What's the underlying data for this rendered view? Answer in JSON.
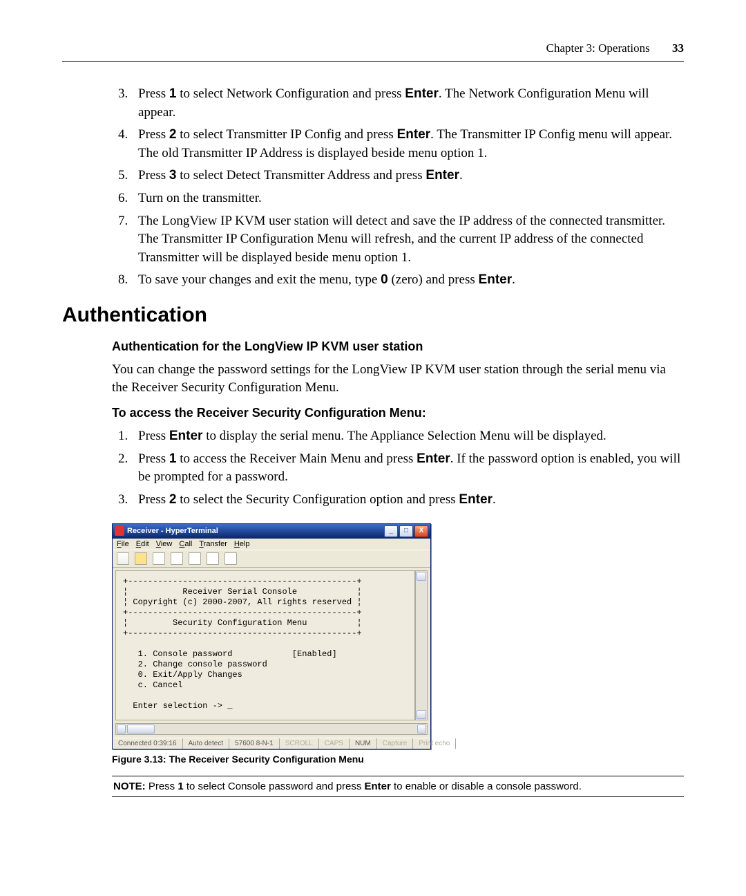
{
  "header": {
    "chapter": "Chapter 3: Operations",
    "page": "33"
  },
  "steps_a": {
    "start": 3,
    "items": [
      "Press <b>1</b> to select Network Configuration and press <b>Enter</b>. The Network Configuration Menu will appear.",
      "Press <b>2</b> to select Transmitter IP Config and press <b>Enter</b>. The Transmitter IP Config menu will appear. The old Transmitter IP Address is displayed beside menu option 1.",
      "Press <b>3</b> to select Detect Transmitter Address and press <b>Enter</b>.",
      "Turn on the transmitter.",
      "The LongView IP KVM user station will detect and save the IP address of the connected transmitter. The Transmitter IP Configuration Menu will refresh, and the current IP address of the connected Transmitter will be displayed beside menu option 1.",
      "To save your changes and exit the menu, type <b>0</b> (zero) and press <b>Enter</b>."
    ]
  },
  "section_title": "Authentication",
  "sub1": "Authentication for the LongView IP KVM user station",
  "para1": "You can change the password settings for the LongView IP KVM user station through the serial menu via the Receiver Security Configuration Menu.",
  "sub2": "To access the Receiver Security Configuration Menu:",
  "steps_b": {
    "start": 1,
    "items": [
      "Press <b>Enter</b> to display the serial menu. The Appliance Selection Menu will be displayed.",
      "Press <b>1</b> to access the Receiver Main Menu and press <b>Enter</b>. If the password option is enabled, you will be prompted for a password.",
      "Press <b>2</b> to select the Security Configuration option and press <b>Enter</b>."
    ]
  },
  "hyperterminal": {
    "title": "Receiver - HyperTerminal",
    "menus": [
      "File",
      "Edit",
      "View",
      "Call",
      "Transfer",
      "Help"
    ],
    "sys": {
      "min": "_",
      "max": "□",
      "close": "X"
    },
    "console_lines": "+----------------------------------------------+\n¦           Receiver Serial Console            ¦\n¦ Copyright (c) 2000-2007, All rights reserved ¦\n+----------------------------------------------+\n¦         Security Configuration Menu          ¦\n+----------------------------------------------+\n\n   1. Console password            [Enabled]\n   2. Change console password\n   0. Exit/Apply Changes\n   c. Cancel\n\n  Enter selection -> _",
    "status": {
      "connected": "Connected 0:39:16",
      "auto": "Auto detect",
      "baud": "57600 8-N-1",
      "scroll": "SCROLL",
      "caps": "CAPS",
      "num": "NUM",
      "capture": "Capture",
      "echo": "Print echo"
    }
  },
  "figure_caption": "Figure 3.13: The Receiver Security Configuration Menu",
  "note": {
    "label": "NOTE:",
    "text": " Press <b>1</b> to select Console password and press <b>Enter</b> to enable or disable a console password."
  }
}
